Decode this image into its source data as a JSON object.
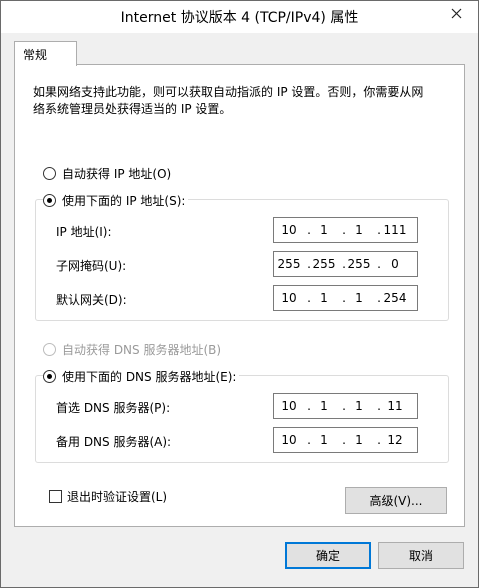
{
  "window": {
    "title": "Internet 协议版本 4 (TCP/IPv4) 属性",
    "close_icon": "close-icon"
  },
  "tabs": [
    {
      "label": "常规",
      "selected": true
    }
  ],
  "general": {
    "description": "如果网络支持此功能，则可以获取自动指派的 IP 设置。否则，你需要从网络系统管理员处获得适当的 IP 设置。",
    "auto_ip_label": "自动获得 IP 地址(O)",
    "manual_ip_label": "使用下面的 IP 地址(S):",
    "ip_mode": "manual",
    "ip_address_label": "IP 地址(I):",
    "ip_address": [
      "10",
      "1",
      "1",
      "111"
    ],
    "subnet_label": "子网掩码(U):",
    "subnet": [
      "255",
      "255",
      "255",
      "0"
    ],
    "gateway_label": "默认网关(D):",
    "gateway": [
      "10",
      "1",
      "1",
      "254"
    ],
    "auto_dns_label": "自动获得 DNS 服务器地址(B)",
    "manual_dns_label": "使用下面的 DNS 服务器地址(E):",
    "dns_mode": "manual",
    "preferred_dns_label": "首选 DNS 服务器(P):",
    "preferred_dns": [
      "10",
      "1",
      "1",
      "11"
    ],
    "alternate_dns_label": "备用 DNS 服务器(A):",
    "alternate_dns": [
      "10",
      "1",
      "1",
      "12"
    ],
    "validate_label": "退出时验证设置(L)",
    "validate_checked": false,
    "advanced_label": "高级(V)..."
  },
  "footer": {
    "ok_label": "确定",
    "cancel_label": "取消"
  },
  "colors": {
    "accent": "#0078d7",
    "dialog_bg": "#f0f0f0",
    "panel_bg": "#ffffff"
  }
}
